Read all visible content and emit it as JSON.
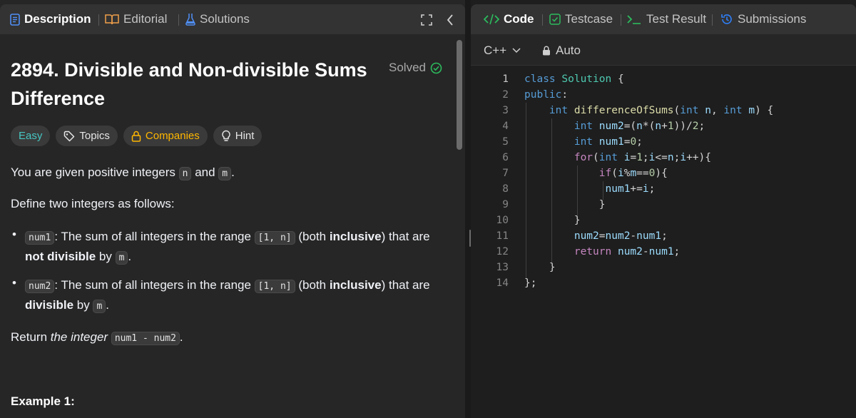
{
  "left_tabs": {
    "description": "Description",
    "editorial": "Editorial",
    "solutions": "Solutions"
  },
  "problem": {
    "title": "2894. Divisible and Non-divisible Sums Difference",
    "status": "Solved",
    "chips": {
      "difficulty": "Easy",
      "topics": "Topics",
      "companies": "Companies",
      "hint": "Hint"
    },
    "intro": {
      "before": "You are given positive integers ",
      "n": "n",
      "and": " and ",
      "m": "m",
      "end": "."
    },
    "define": "Define two integers as follows:",
    "bullet1": {
      "var": "num1",
      "p1": ": The sum of all integers in the range ",
      "range": "[1, n]",
      "p2": " (both ",
      "incl": "inclusive",
      "p3": ") that are ",
      "bold": "not divisible",
      "p4": " by ",
      "m": "m",
      "end": "."
    },
    "bullet2": {
      "var": "num2",
      "p1": ": The sum of all integers in the range ",
      "range": "[1, n]",
      "p2": " (both ",
      "incl": "inclusive",
      "p3": ") that are ",
      "bold": "divisible",
      "p4": " by ",
      "m": "m",
      "end": "."
    },
    "return_text": {
      "before": "Return ",
      "italic": "the integer",
      "code": "num1 - num2",
      "end": "."
    },
    "example_title": "Example 1:"
  },
  "right_tabs": {
    "code": "Code",
    "testcase": "Testcase",
    "test_result": "Test Result",
    "submissions": "Submissions"
  },
  "editor": {
    "language": "C++",
    "mode": "Auto",
    "line_numbers": [
      "1",
      "2",
      "3",
      "4",
      "5",
      "6",
      "7",
      "8",
      "9",
      "10",
      "11",
      "12",
      "13",
      "14"
    ]
  },
  "colors": {
    "easy": "#46c6c2",
    "companies": "#ffb700",
    "solved_check": "#2cbb5d",
    "code_tab_icon": "#2cbb5d",
    "submissions_icon": "#2f7ff8"
  }
}
